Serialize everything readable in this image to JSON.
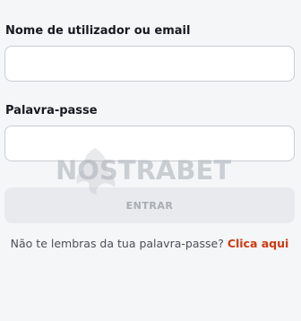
{
  "form": {
    "username_label": "Nome de utilizador ou email",
    "username_value": "",
    "password_label": "Palavra-passe",
    "password_value": "",
    "submit_label": "ENTRAR",
    "forgot_text": "Não te lembras da tua palavra-passe? ",
    "forgot_link": "Clica aqui"
  },
  "watermark": {
    "text": "NOSTRABET"
  },
  "colors": {
    "background": "#f5f6f8",
    "link": "#cf3a0e",
    "button_disabled": "#e8eaed"
  }
}
